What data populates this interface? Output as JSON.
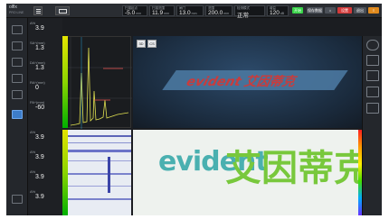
{
  "brand": {
    "logo": "olflx",
    "sub": "PRO LINE"
  },
  "params": [
    {
      "label": "扫描起点",
      "value": "-5.0",
      "unit": "mm"
    },
    {
      "label": "扫描范围",
      "value": "11.9",
      "unit": "mm"
    },
    {
      "label": "闸门",
      "value": "13.0",
      "unit": "mm"
    },
    {
      "label": "范围",
      "value": "200.0",
      "unit": "mm"
    },
    {
      "label": "检测模式",
      "value": "正常",
      "unit": ""
    },
    {
      "label": "增益",
      "value": "120",
      "unit": "dB"
    }
  ],
  "filename": "logo_plate_raw_1",
  "badges": [
    "开始",
    "保存数据",
    "设置",
    "退出"
  ],
  "readings": [
    {
      "label": "A%",
      "value": "3.9"
    },
    {
      "label": "SA^(mm)",
      "value": "1.3"
    },
    {
      "label": "DA^(mm)",
      "value": "1.3"
    },
    {
      "label": "RA^(mm)",
      "value": "0"
    },
    {
      "label": "PA^(mm)",
      "value": "-60"
    },
    {
      "label": "A%",
      "value": "3.9"
    },
    {
      "label": "A%",
      "value": "3.9"
    },
    {
      "label": "A%",
      "value": "3.9"
    },
    {
      "label": "A%",
      "value": "3.9"
    }
  ],
  "view3d": {
    "tabs": [
      "3D",
      "CS"
    ],
    "plate_text": "evident 艾因蒂克"
  },
  "cscan": {
    "logo_text": "evident",
    "cn_text": "艾因蒂克"
  },
  "colors": {
    "accent": "#3d7dca",
    "green": "#37d447",
    "red": "#d43a3a",
    "yellow": "#e4e400"
  }
}
